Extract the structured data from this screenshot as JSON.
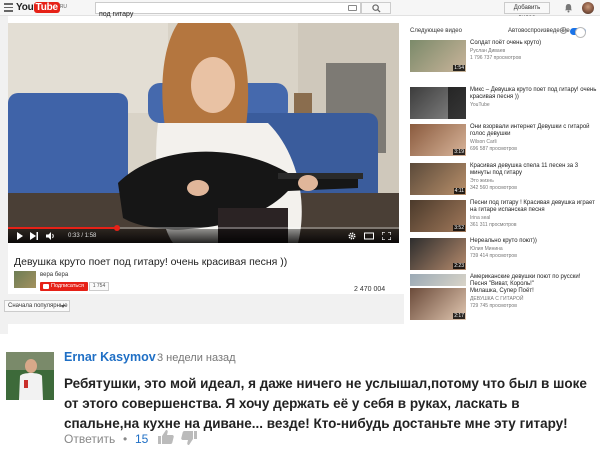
{
  "header": {
    "logo_you": "You",
    "logo_tube": "Tube",
    "logo_region": "RU",
    "search_value": "под гитару",
    "add_video_label": "Добавить видео"
  },
  "player": {
    "time_current": "0:33",
    "time_total": "1:58",
    "time_separator": " / ",
    "progress_fraction": 0.28
  },
  "video": {
    "title": "Девушка круто поет под гитару! очень красивая песня ))",
    "channel": "вера бера",
    "subscribe_label": "Подписаться",
    "subscribers": "1 754",
    "views": "2 470 004"
  },
  "sort_label": "Сначала популярные",
  "sidebar": {
    "heading": "Следующее видео",
    "autoplay_label": "Автовоспроизведение",
    "autoplay_info": "i",
    "items": [
      {
        "title": "Солдат поёт очень круто)",
        "channel": "Руслан Диваев",
        "views": "1 796 737 просмотров",
        "duration": "1:54",
        "colors": [
          "#7b8a6a",
          "#c9b49a"
        ]
      },
      {
        "title": "Микс – Девушка круто поет под гитару! очень красивая песня ))",
        "channel": "YouTube",
        "views": "",
        "duration": "",
        "colors": [
          "#3c3c3c",
          "#8a8a8a"
        ]
      },
      {
        "title": "Они взорвали интернет Девушки с гитарой голос девушки",
        "channel": "Wilson Carli",
        "views": "696 587 просмотров",
        "duration": "3:19",
        "colors": [
          "#8a5b3e",
          "#d8b49a"
        ]
      },
      {
        "title": "Красивая девушка спела 11 песен за 3 минуты под гитару",
        "channel": "Это жизнь",
        "views": "342 560 просмотров",
        "duration": "4:11",
        "colors": [
          "#5b4a3a",
          "#b88f6a"
        ]
      },
      {
        "title": "Песни под гитару ! Красивая девушка играет на гитаре испанская песня",
        "channel": "Irina seal",
        "views": "361 311 просмотров",
        "duration": "3:52",
        "colors": [
          "#4b3a2b",
          "#a0785a"
        ]
      },
      {
        "title": "Нереально круто поют))",
        "channel": "Юлия Минина",
        "views": "739 414 просмотров",
        "duration": "2:23",
        "colors": [
          "#2d2d2d",
          "#b58a6c"
        ]
      },
      {
        "title": "Американские девушки поют по русски! Песня \"Виват, Король!\"",
        "channel": "",
        "views": "",
        "duration": "",
        "colors": [
          "#9aa9b5",
          "#d9d4c8"
        ]
      },
      {
        "title": "Милашка, Супер Поёт!",
        "channel": "ДЕВУШКА С ГИТАРОЙ",
        "views": "729 745 просмотров",
        "duration": "2:17",
        "colors": [
          "#6b4b3a",
          "#e0c6b0"
        ]
      }
    ]
  },
  "comment": {
    "author": "Ernar Kasymov",
    "time": "3 недели назад",
    "text": "Ребятушки, это мой идеал, я даже ничего не услышал,потому что был в шоке от этого совершенства. Я хочу держать её у себя в руках, ласкать в спальне,на кухне на диване... везде!  Кто-нибудь достаньте мне эту гитару!",
    "reply_label": "Ответить",
    "separator": "•",
    "likes": "15"
  }
}
